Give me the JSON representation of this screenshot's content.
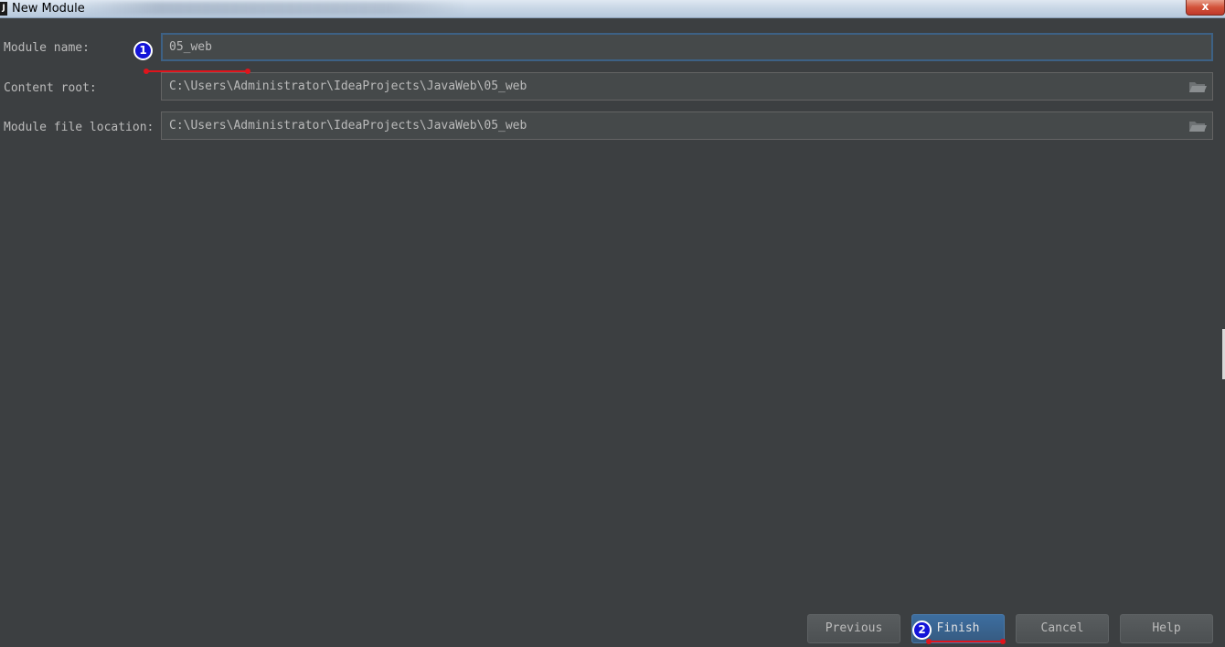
{
  "window": {
    "title": "New Module",
    "app_icon_label": "J",
    "close_label": "x"
  },
  "form": {
    "module_name": {
      "label": "Module name:",
      "value": "05_web"
    },
    "content_root": {
      "label": "Content root:",
      "value": "C:\\Users\\Administrator\\IdeaProjects\\JavaWeb\\05_web",
      "browse_icon": "folder-icon"
    },
    "module_file_location": {
      "label": "Module file location:",
      "value": "C:\\Users\\Administrator\\IdeaProjects\\JavaWeb\\05_web",
      "browse_icon": "folder-icon"
    }
  },
  "annotations": {
    "step1": "1",
    "step2": "2",
    "marker_color": "#1414d8",
    "underline_color": "#e0141c"
  },
  "buttons": {
    "previous": "Previous",
    "finish": "Finish",
    "cancel": "Cancel",
    "help": "Help"
  },
  "colors": {
    "background": "#3c3f41",
    "field_bg": "#45494a",
    "focus_border": "#3d6185",
    "primary_button": "#365a80"
  }
}
